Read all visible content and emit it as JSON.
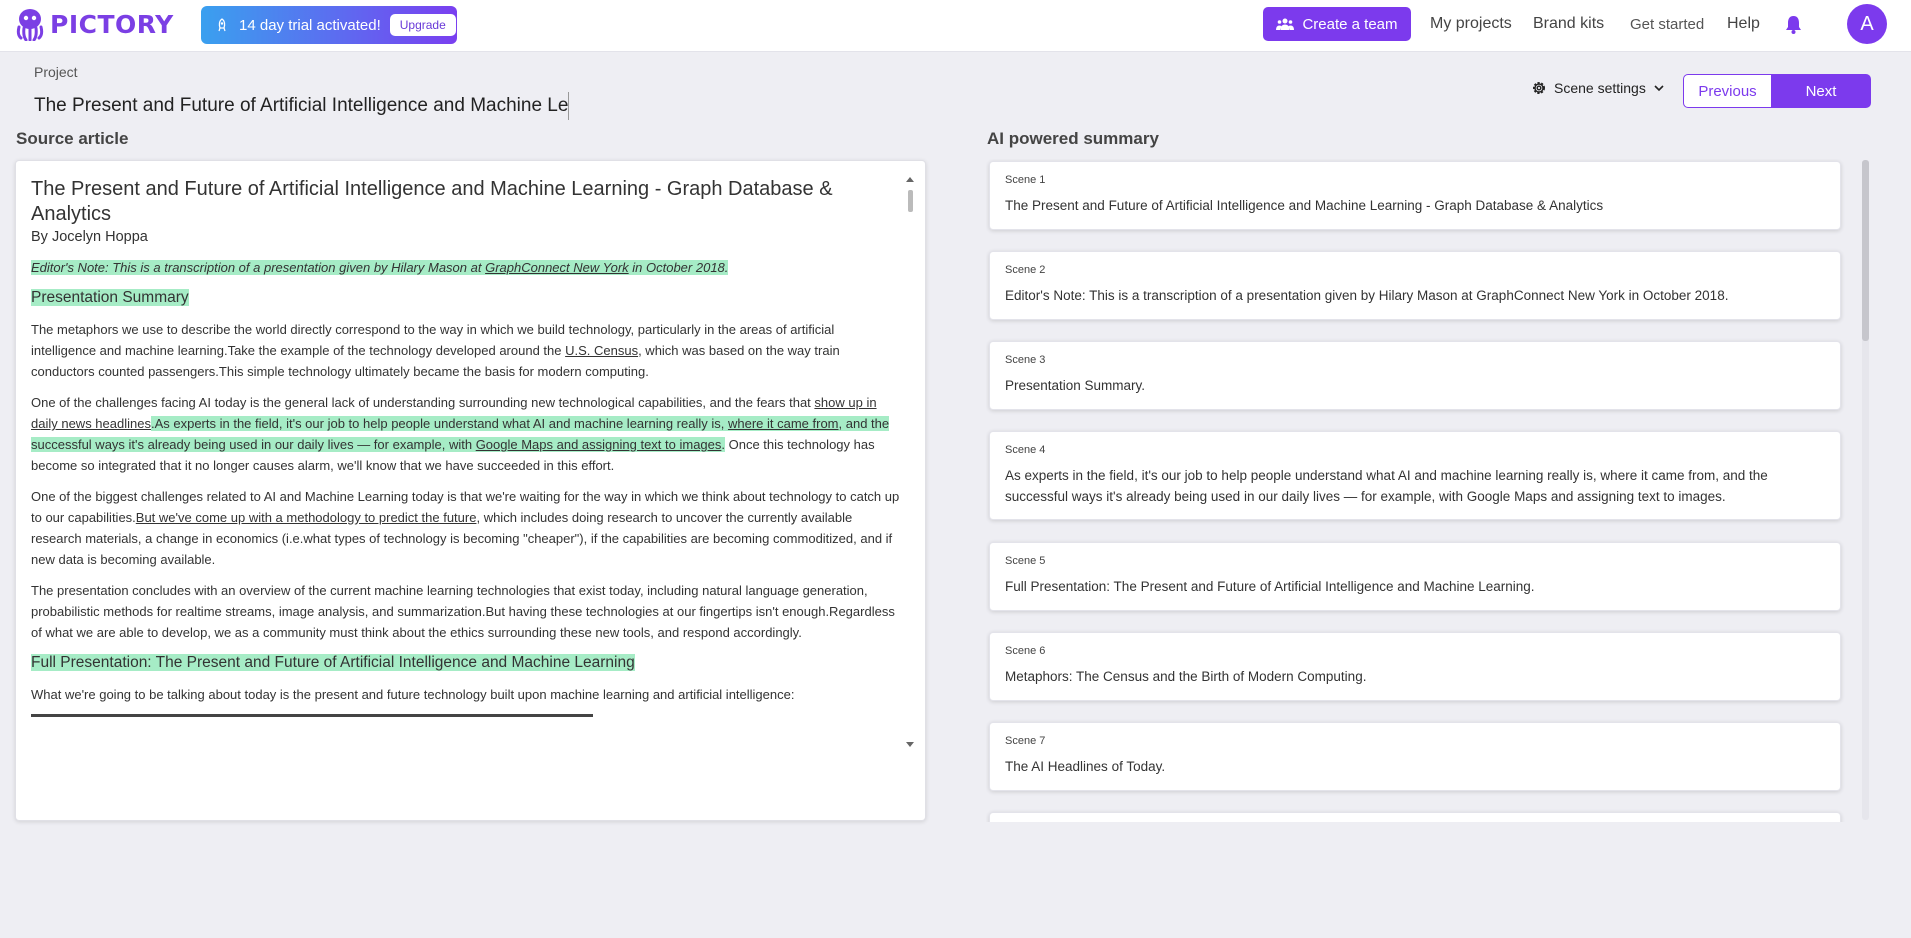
{
  "header": {
    "brand": "PICTORY",
    "trial_text": "14 day trial activated!",
    "upgrade_label": "Upgrade",
    "create_team_label": "Create a team",
    "nav": {
      "my_projects": "My projects",
      "brand_kits": "Brand kits",
      "get_started": "Get started",
      "help": "Help"
    },
    "avatar_initial": "A"
  },
  "project": {
    "label": "Project",
    "title": "The Present and Future of Artificial Intelligence and Machine Learning - Graph Database & Analytics",
    "scene_settings_label": "Scene settings",
    "previous_label": "Previous",
    "next_label": "Next"
  },
  "source": {
    "heading": "Source article",
    "title": "The Present and Future of Artificial Intelligence and Machine Learning - Graph Database & Analytics",
    "author": "By Jocelyn Hoppa",
    "editors_note": {
      "a": "Editor's Note: This is a transcription of a presentation given by Hilary Mason at ",
      "link": "GraphConnect New York",
      "b": " in October 2018."
    },
    "summary_heading": "Presentation Summary",
    "p1": {
      "a": "The metaphors we use to describe the world directly correspond to the way in which we build technology, particularly in the areas of artificial intelligence and machine learning.Take the example of the technology developed around the ",
      "link": "U.S. Census",
      "b": ", which was based on the way train conductors counted passengers.This simple technology ultimately became the basis for modern computing."
    },
    "p2": {
      "a": "One of the challenges facing AI today is the general lack of understanding surrounding new technological capabilities, and the fears that ",
      "link1": "show up in daily news headlines",
      "hl1": ".As experts in the field, it's our job to help people understand what AI and machine learning really is, ",
      "link2": "where it came from",
      "hl2": ", and the successful ways it's already being used in our daily lives — for example, with ",
      "link3": "Google Maps and assigning text to images",
      "hl3": ".",
      "b": " Once this technology has become so integrated that it no longer causes alarm, we'll know that we have succeeded in this effort."
    },
    "p3": {
      "a": "One of the biggest challenges related to AI and Machine Learning today is that we're waiting for the way in which we think about technology to catch up to our capabilities.",
      "link": "But we've come up with a methodology to predict the future",
      "b": ", which includes doing research to uncover the currently available research materials, a change in economics (i.e.what types of technology is becoming \"cheaper\"), if the capabilities are becoming commoditized, and if new data is becoming available."
    },
    "p4": "The presentation concludes with an overview of the current machine learning technologies that exist today, including natural language generation, probabilistic methods for realtime streams, image analysis, and summarization.But having these technologies at our fingertips isn't enough.Regardless of what we are able to develop, we as a community must think about the ethics surrounding these new tools, and respond accordingly.",
    "full_heading": "Full Presentation: The Present and Future of Artificial Intelligence and Machine Learning",
    "p5": "What we're going to be talking about today is the present and future technology built upon machine learning and artificial intelligence:"
  },
  "summary": {
    "heading": "AI powered summary",
    "scenes": [
      {
        "label": "Scene 1",
        "text": "The Present and Future of Artificial Intelligence and Machine Learning - Graph Database & Analytics"
      },
      {
        "label": "Scene 2",
        "text": "Editor's Note: This is a transcription of a presentation given by Hilary Mason at GraphConnect New York in October 2018."
      },
      {
        "label": "Scene 3",
        "text": "Presentation Summary."
      },
      {
        "label": "Scene 4",
        "text": "As experts in the field, it's our job to help people understand what AI and machine learning really is, where it came from, and the successful ways it's already being used in our daily lives — for example, with Google Maps and assigning text to images."
      },
      {
        "label": "Scene 5",
        "text": "Full Presentation: The Present and Future of Artificial Intelligence and Machine Learning."
      },
      {
        "label": "Scene 6",
        "text": "Metaphors: The Census and the Birth of Modern Computing."
      },
      {
        "label": "Scene 7",
        "text": "The AI Headlines of Today."
      }
    ]
  },
  "colors": {
    "brand_purple": "#7c3aed",
    "highlight_green": "#a6ecc6",
    "background": "#eeeef3"
  },
  "icons": [
    "octopus-logo-icon",
    "rocket-icon",
    "team-icon",
    "bell-icon",
    "gear-icon",
    "chevron-down-icon"
  ]
}
